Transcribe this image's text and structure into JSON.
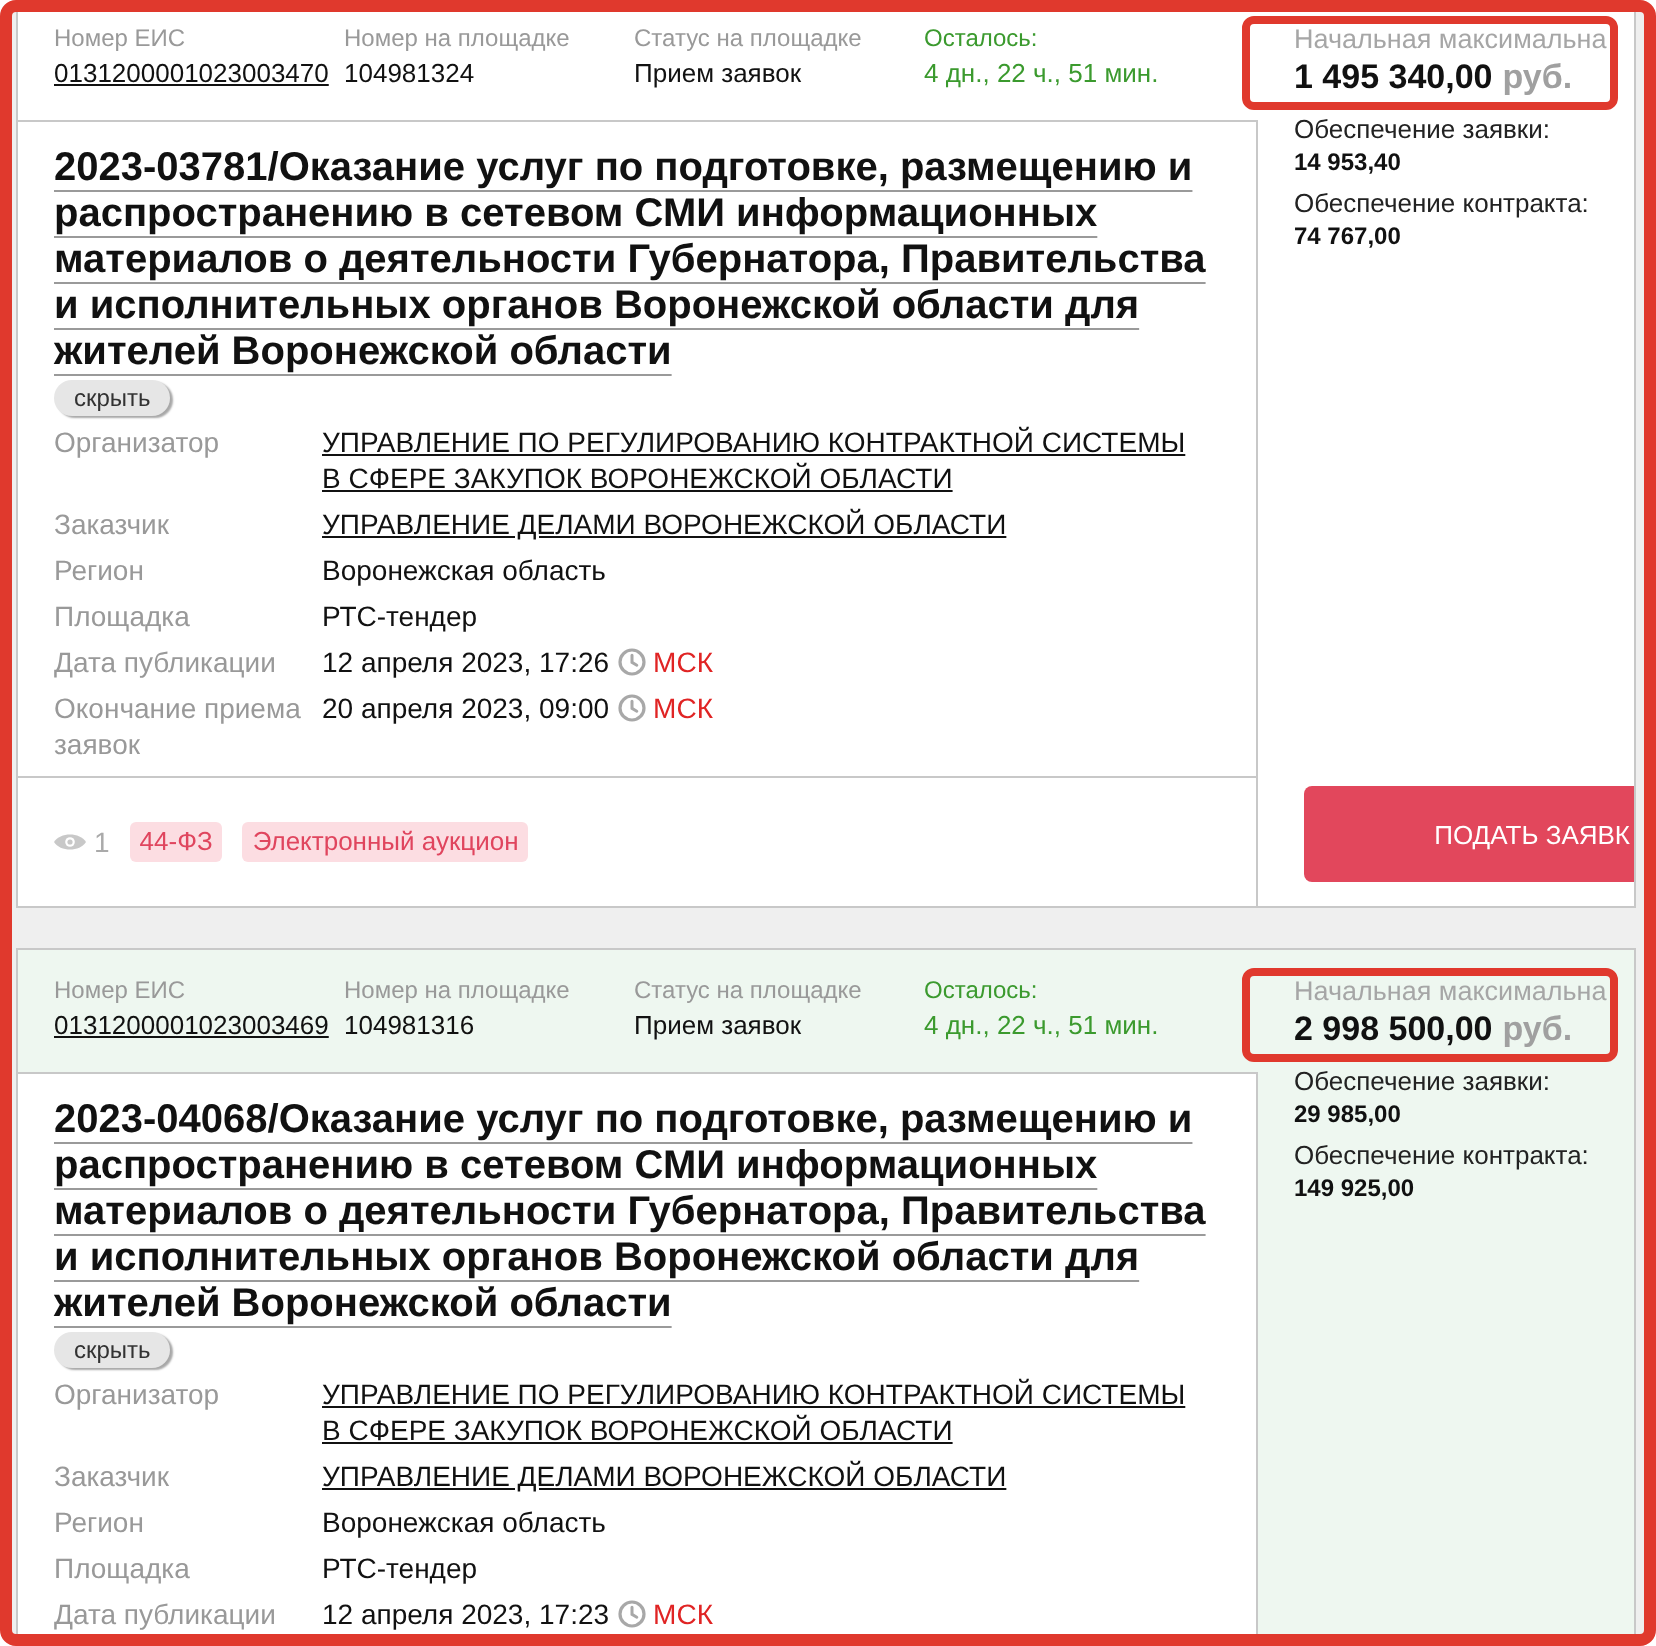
{
  "annotation_frame": true,
  "tenders": [
    {
      "selected": false,
      "header": [
        {
          "kind": "link",
          "label": "Номер ЕИС",
          "value": "0131200001023003470"
        },
        {
          "kind": "text",
          "label": "Номер на площадке",
          "value": "104981324"
        },
        {
          "kind": "text",
          "label": "Статус на площадке",
          "value": "Прием заявок"
        },
        {
          "kind": "countdown",
          "label": "Осталось:",
          "value": "4 дн., 22 ч., 51 мин."
        }
      ],
      "title": "2023-03781/Оказание услуг по подготовке, размещению и распространению в сетевом СМИ информационных материалов о деятельности Губернатора, Правительства и исполнительных органов Воронежской области для жителей Воронежской области",
      "hide_button": "скрыть",
      "details": [
        {
          "kind": "link",
          "label": "Организатор",
          "value": "УПРАВЛЕНИЕ ПО РЕГУЛИРОВАНИЮ КОНТРАКТНОЙ СИСТЕМЫ В СФЕРЕ ЗАКУПОК ВОРОНЕЖСКОЙ ОБЛАСТИ"
        },
        {
          "kind": "link",
          "label": "Заказчик",
          "value": "УПРАВЛЕНИЕ ДЕЛАМИ ВОРОНЕЖСКОЙ ОБЛАСТИ"
        },
        {
          "kind": "text",
          "label": "Регион",
          "value": "Воронежская область"
        },
        {
          "kind": "text",
          "label": "Площадка",
          "value": "РТС-тендер"
        },
        {
          "kind": "datetime",
          "label": "Дата публикации",
          "value": "12 апреля 2023, 17:26",
          "zone": "МСК"
        },
        {
          "kind": "datetime",
          "label": "Окончание приема заявок",
          "value": "20 апреля 2023, 09:00",
          "zone": "МСК"
        }
      ],
      "footer": {
        "views": "1",
        "tags": [
          "44-ФЗ",
          "Электронный аукцион"
        ]
      },
      "price": {
        "label": "Начальная максимальна",
        "amount": "1 495 340,00",
        "currency": "руб.",
        "highlighted": true
      },
      "guarantees": [
        {
          "label": "Обеспечение заявки:",
          "value": "14 953,40"
        },
        {
          "label": "Обеспечение контракта:",
          "value": "74 767,00"
        }
      ],
      "apply_button": "ПОДАТЬ ЗАЯВК"
    },
    {
      "selected": true,
      "header": [
        {
          "kind": "link",
          "label": "Номер ЕИС",
          "value": "0131200001023003469"
        },
        {
          "kind": "text",
          "label": "Номер на площадке",
          "value": "104981316"
        },
        {
          "kind": "text",
          "label": "Статус на площадке",
          "value": "Прием заявок"
        },
        {
          "kind": "countdown",
          "label": "Осталось:",
          "value": "4 дн., 22 ч., 51 мин."
        }
      ],
      "title": "2023-04068/Оказание услуг по подготовке, размещению и распространению в сетевом СМИ информационных материалов о деятельности Губернатора, Правительства и исполнительных органов Воронежской области для жителей Воронежской области",
      "hide_button": "скрыть",
      "details": [
        {
          "kind": "link",
          "label": "Организатор",
          "value": "УПРАВЛЕНИЕ ПО РЕГУЛИРОВАНИЮ КОНТРАКТНОЙ СИСТЕМЫ В СФЕРЕ ЗАКУПОК ВОРОНЕЖСКОЙ ОБЛАСТИ"
        },
        {
          "kind": "link",
          "label": "Заказчик",
          "value": "УПРАВЛЕНИЕ ДЕЛАМИ ВОРОНЕЖСКОЙ ОБЛАСТИ"
        },
        {
          "kind": "text",
          "label": "Регион",
          "value": "Воронежская область"
        },
        {
          "kind": "text",
          "label": "Площадка",
          "value": "РТС-тендер"
        },
        {
          "kind": "datetime",
          "label": "Дата публикации",
          "value": "12 апреля 2023, 17:23",
          "zone": "МСК"
        }
      ],
      "price": {
        "label": "Начальная максимальна",
        "amount": "2 998 500,00",
        "currency": "руб.",
        "highlighted": true
      },
      "guarantees": [
        {
          "label": "Обеспечение заявки:",
          "value": "29 985,00"
        },
        {
          "label": "Обеспечение контракта:",
          "value": "149 925,00"
        }
      ]
    }
  ]
}
